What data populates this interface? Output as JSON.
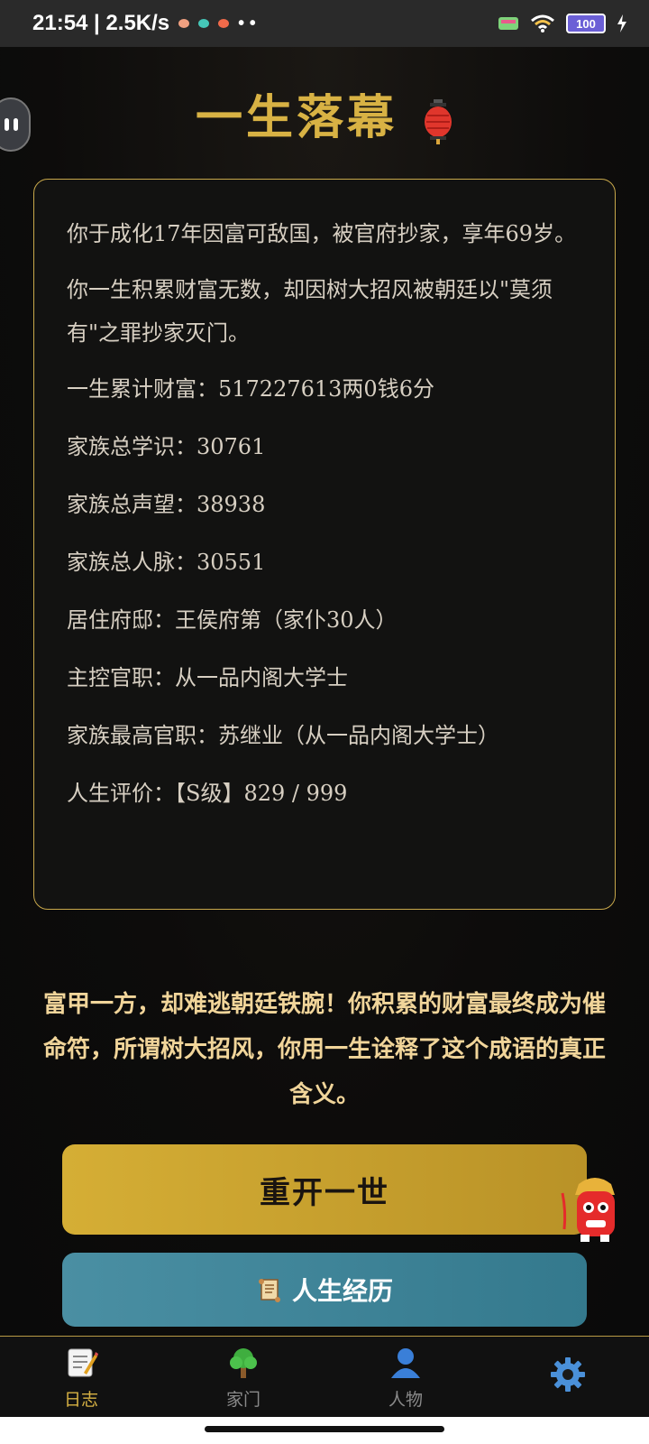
{
  "status_bar": {
    "time_speed": "21:54 | 2.5K/s",
    "battery": "100"
  },
  "title": "一生落幕",
  "summary": {
    "paragraphs": [
      "你于成化17年因富可敌国，被官府抄家，享年69岁。",
      "你一生积累财富无数，却因树大招风被朝廷以\"莫须有\"之罪抄家灭门。"
    ],
    "stats": [
      "一生累计财富：517227613两0钱6分",
      "家族总学识：30761",
      "家族总声望：38938",
      "家族总人脉：30551",
      "居住府邸：王侯府第（家仆30人）",
      "主控官职：从一品内阁大学士",
      "家族最高官职：苏继业（从一品内阁大学士）",
      "人生评价：【S级】829 / 999"
    ]
  },
  "verdict": "富甲一方，却难逃朝廷铁腕！你积累的财富最终成为催命符，所谓树大招风，你用一生诠释了这个成语的真正含义。",
  "buttons": {
    "restart": "重开一世",
    "life_history": "人生经历"
  },
  "tabs": [
    {
      "label": "日志",
      "icon": "memo-icon",
      "active": true
    },
    {
      "label": "家门",
      "icon": "tree-icon",
      "active": false
    },
    {
      "label": "人物",
      "icon": "person-icon",
      "active": false
    },
    {
      "label": "",
      "icon": "gear-icon",
      "active": false
    }
  ],
  "colors": {
    "accent_gold": "#d8b244",
    "button_blue": "#3f869a",
    "tab_active": "#d8b244",
    "tab_inactive": "#8a8a8a"
  }
}
